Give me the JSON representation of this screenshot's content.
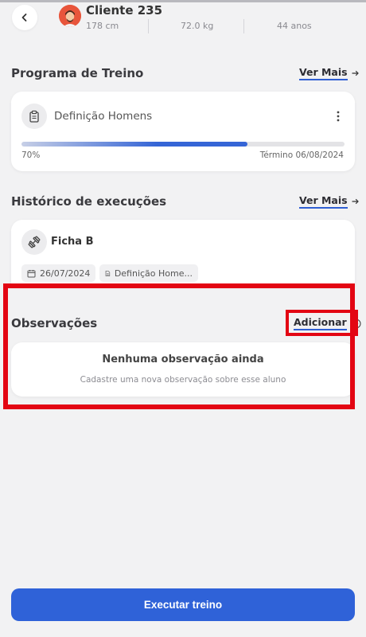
{
  "header": {
    "client_name": "Cliente 235",
    "height": "178 cm",
    "weight": "72.0 kg",
    "age": "44 anos"
  },
  "program": {
    "section_title": "Programa de Treino",
    "more_label": "Ver Mais",
    "name": "Definição Homens",
    "progress_fraction": 0.7,
    "progress_label": "70%",
    "end_label": "Término 06/08/2024"
  },
  "history": {
    "section_title": "Histórico de execuções",
    "more_label": "Ver Mais",
    "sheet_name": "Ficha B",
    "date": "26/07/2024",
    "program_short": "Definição Home..."
  },
  "notes": {
    "section_title": "Observações",
    "add_label": "Adicionar",
    "empty_title": "Nenhuma observação ainda",
    "empty_subtitle": "Cadastre uma nova observação sobre esse aluno"
  },
  "footer": {
    "execute_label": "Executar treino"
  },
  "colors": {
    "accent": "#2f62d8",
    "highlight": "#e30613",
    "background": "#f2f2f3"
  }
}
